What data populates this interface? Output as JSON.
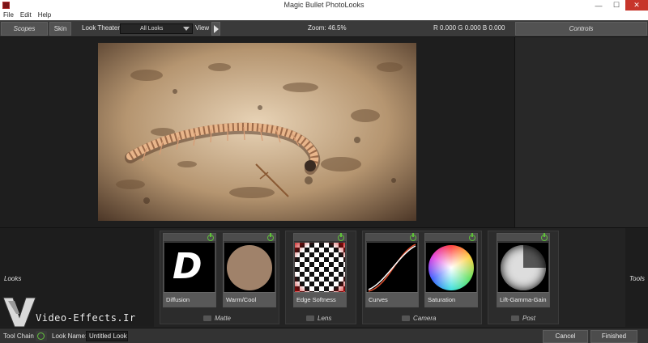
{
  "window": {
    "title": "Magic Bullet PhotoLooks",
    "minimize": "—",
    "maximize": "☐",
    "close": "✕"
  },
  "menu": [
    "File",
    "Edit",
    "Help"
  ],
  "toolbar": {
    "scopes_label": "Scopes",
    "skin_label": "Skin",
    "look_theater_label": "Look Theater",
    "look_select_value": "All Looks",
    "view_label": "View",
    "zoom_text": "Zoom:  46.5%",
    "rgb_text": "R 0.000   G 0.000   B 0.000",
    "controls_label": "Controls"
  },
  "tools_area": {
    "looks_label": "Looks",
    "tools_label": "Tools",
    "groups": [
      {
        "label": "Matte"
      },
      {
        "label": "Lens"
      },
      {
        "label": "Camera"
      },
      {
        "label": "Post"
      }
    ],
    "tools": [
      {
        "name": "Diffusion",
        "thumb_letter": "D"
      },
      {
        "name": "Warm/Cool",
        "thumb_color": "#a0826a"
      },
      {
        "name": "Edge Softness"
      },
      {
        "name": "Curves"
      },
      {
        "name": "Saturation"
      },
      {
        "name": "Lift-Gamma-Gain"
      }
    ]
  },
  "statusbar": {
    "tool_chain_label": "Tool Chain",
    "look_name_label": "Look Name:",
    "look_name_value": "Untitled Look",
    "cancel_label": "Cancel",
    "finished_label": "Finished"
  },
  "watermark": {
    "text": "Video-Effects.Ir"
  },
  "colors": {
    "accent_power": "#5fbf3a",
    "close_button": "#c7352b",
    "panel": "#3a3a3a"
  }
}
